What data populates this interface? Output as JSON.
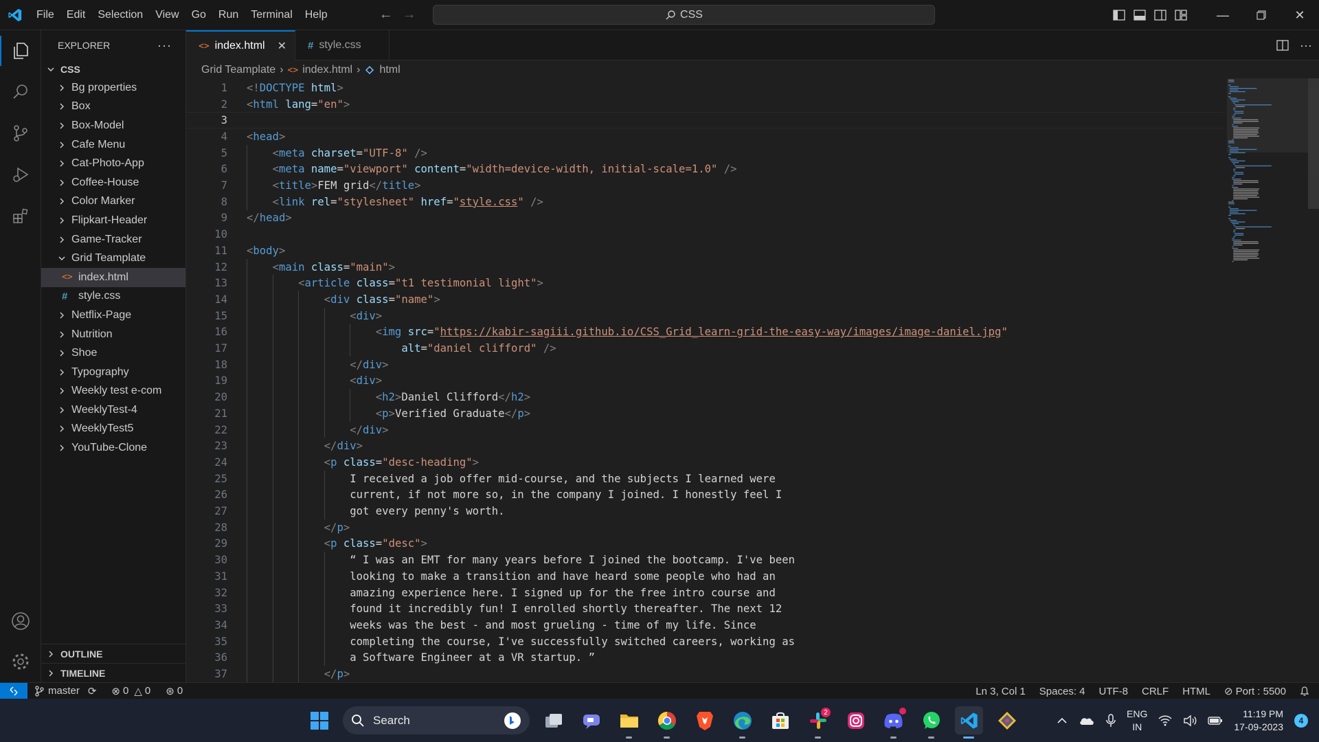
{
  "menu": [
    "File",
    "Edit",
    "Selection",
    "View",
    "Go",
    "Run",
    "Terminal",
    "Help"
  ],
  "command_center": "CSS",
  "explorer": {
    "title": "EXPLORER",
    "root": "CSS",
    "folders_before": [
      "Bg properties",
      "Box",
      "Box-Model",
      "Cafe Menu",
      "Cat-Photo-App",
      "Coffee-House",
      "Color Marker",
      "Flipkart-Header",
      "Game-Tracker"
    ],
    "open_folder": "Grid Teamplate",
    "files": [
      "index.html",
      "style.css"
    ],
    "folders_after": [
      "Netflix-Page",
      "Nutrition",
      "Shoe",
      "Typography",
      "Weekly test e-com",
      "WeeklyTest-4",
      "WeeklyTest5",
      "YouTube-Clone"
    ],
    "outline": "OUTLINE",
    "timeline": "TIMELINE"
  },
  "tabs": [
    {
      "label": "index.html",
      "active": true
    },
    {
      "label": "style.css",
      "active": false
    }
  ],
  "breadcrumb": [
    "Grid Teamplate",
    "index.html",
    "html"
  ],
  "editor": {
    "current_line": 3,
    "lines": [
      [
        [
          "br",
          "<!"
        ],
        [
          "doc",
          "DOCTYPE"
        ],
        [
          "text",
          " "
        ],
        [
          "attr",
          "html"
        ],
        [
          "br",
          ">"
        ]
      ],
      [
        [
          "br",
          "<"
        ],
        [
          "tag",
          "html"
        ],
        [
          "text",
          " "
        ],
        [
          "attr",
          "lang"
        ],
        [
          "text",
          "="
        ],
        [
          "str",
          "\"en\""
        ],
        [
          "br",
          ">"
        ]
      ],
      [],
      [
        [
          "br",
          "<"
        ],
        [
          "tag",
          "head"
        ],
        [
          "br",
          ">"
        ]
      ],
      [
        [
          "text",
          "    "
        ],
        [
          "br",
          "<"
        ],
        [
          "tag",
          "meta"
        ],
        [
          "text",
          " "
        ],
        [
          "attr",
          "charset"
        ],
        [
          "text",
          "="
        ],
        [
          "str",
          "\"UTF-8\""
        ],
        [
          "text",
          " "
        ],
        [
          "br",
          "/>"
        ]
      ],
      [
        [
          "text",
          "    "
        ],
        [
          "br",
          "<"
        ],
        [
          "tag",
          "meta"
        ],
        [
          "text",
          " "
        ],
        [
          "attr",
          "name"
        ],
        [
          "text",
          "="
        ],
        [
          "str",
          "\"viewport\""
        ],
        [
          "text",
          " "
        ],
        [
          "attr",
          "content"
        ],
        [
          "text",
          "="
        ],
        [
          "str",
          "\"width=device-width, initial-scale=1.0\""
        ],
        [
          "text",
          " "
        ],
        [
          "br",
          "/>"
        ]
      ],
      [
        [
          "text",
          "    "
        ],
        [
          "br",
          "<"
        ],
        [
          "tag",
          "title"
        ],
        [
          "br",
          ">"
        ],
        [
          "text",
          "FEM grid"
        ],
        [
          "br",
          "</"
        ],
        [
          "tag",
          "title"
        ],
        [
          "br",
          ">"
        ]
      ],
      [
        [
          "text",
          "    "
        ],
        [
          "br",
          "<"
        ],
        [
          "tag",
          "link"
        ],
        [
          "text",
          " "
        ],
        [
          "attr",
          "rel"
        ],
        [
          "text",
          "="
        ],
        [
          "str",
          "\"stylesheet\""
        ],
        [
          "text",
          " "
        ],
        [
          "attr",
          "href"
        ],
        [
          "text",
          "="
        ],
        [
          "str",
          "\""
        ],
        [
          "link",
          "style.css"
        ],
        [
          "str",
          "\""
        ],
        [
          "text",
          " "
        ],
        [
          "br",
          "/>"
        ]
      ],
      [
        [
          "br",
          "</"
        ],
        [
          "tag",
          "head"
        ],
        [
          "br",
          ">"
        ]
      ],
      [],
      [
        [
          "br",
          "<"
        ],
        [
          "tag",
          "body"
        ],
        [
          "br",
          ">"
        ]
      ],
      [
        [
          "text",
          "    "
        ],
        [
          "br",
          "<"
        ],
        [
          "tag",
          "main"
        ],
        [
          "text",
          " "
        ],
        [
          "attr",
          "class"
        ],
        [
          "text",
          "="
        ],
        [
          "str",
          "\"main\""
        ],
        [
          "br",
          ">"
        ]
      ],
      [
        [
          "text",
          "        "
        ],
        [
          "br",
          "<"
        ],
        [
          "tag",
          "article"
        ],
        [
          "text",
          " "
        ],
        [
          "attr",
          "class"
        ],
        [
          "text",
          "="
        ],
        [
          "str",
          "\"t1 testimonial light\""
        ],
        [
          "br",
          ">"
        ]
      ],
      [
        [
          "text",
          "            "
        ],
        [
          "br",
          "<"
        ],
        [
          "tag",
          "div"
        ],
        [
          "text",
          " "
        ],
        [
          "attr",
          "class"
        ],
        [
          "text",
          "="
        ],
        [
          "str",
          "\"name\""
        ],
        [
          "br",
          ">"
        ]
      ],
      [
        [
          "text",
          "                "
        ],
        [
          "br",
          "<"
        ],
        [
          "tag",
          "div"
        ],
        [
          "br",
          ">"
        ]
      ],
      [
        [
          "text",
          "                    "
        ],
        [
          "br",
          "<"
        ],
        [
          "tag",
          "img"
        ],
        [
          "text",
          " "
        ],
        [
          "attr",
          "src"
        ],
        [
          "text",
          "="
        ],
        [
          "str",
          "\""
        ],
        [
          "link",
          "https://kabir-sagiii.github.io/CSS_Grid_learn-grid-the-easy-way/images/image-daniel.jpg"
        ],
        [
          "str",
          "\""
        ]
      ],
      [
        [
          "text",
          "                        "
        ],
        [
          "attr",
          "alt"
        ],
        [
          "text",
          "="
        ],
        [
          "str",
          "\"daniel clifford\""
        ],
        [
          "text",
          " "
        ],
        [
          "br",
          "/>"
        ]
      ],
      [
        [
          "text",
          "                "
        ],
        [
          "br",
          "</"
        ],
        [
          "tag",
          "div"
        ],
        [
          "br",
          ">"
        ]
      ],
      [
        [
          "text",
          "                "
        ],
        [
          "br",
          "<"
        ],
        [
          "tag",
          "div"
        ],
        [
          "br",
          ">"
        ]
      ],
      [
        [
          "text",
          "                    "
        ],
        [
          "br",
          "<"
        ],
        [
          "tag",
          "h2"
        ],
        [
          "br",
          ">"
        ],
        [
          "text",
          "Daniel Clifford"
        ],
        [
          "br",
          "</"
        ],
        [
          "tag",
          "h2"
        ],
        [
          "br",
          ">"
        ]
      ],
      [
        [
          "text",
          "                    "
        ],
        [
          "br",
          "<"
        ],
        [
          "tag",
          "p"
        ],
        [
          "br",
          ">"
        ],
        [
          "text",
          "Verified Graduate"
        ],
        [
          "br",
          "</"
        ],
        [
          "tag",
          "p"
        ],
        [
          "br",
          ">"
        ]
      ],
      [
        [
          "text",
          "                "
        ],
        [
          "br",
          "</"
        ],
        [
          "tag",
          "div"
        ],
        [
          "br",
          ">"
        ]
      ],
      [
        [
          "text",
          "            "
        ],
        [
          "br",
          "</"
        ],
        [
          "tag",
          "div"
        ],
        [
          "br",
          ">"
        ]
      ],
      [
        [
          "text",
          "            "
        ],
        [
          "br",
          "<"
        ],
        [
          "tag",
          "p"
        ],
        [
          "text",
          " "
        ],
        [
          "attr",
          "class"
        ],
        [
          "text",
          "="
        ],
        [
          "str",
          "\"desc-heading\""
        ],
        [
          "br",
          ">"
        ]
      ],
      [
        [
          "text",
          "                I received a job offer mid-course, and the subjects I learned were"
        ]
      ],
      [
        [
          "text",
          "                current, if not more so, in the company I joined. I honestly feel I"
        ]
      ],
      [
        [
          "text",
          "                got every penny's worth."
        ]
      ],
      [
        [
          "text",
          "            "
        ],
        [
          "br",
          "</"
        ],
        [
          "tag",
          "p"
        ],
        [
          "br",
          ">"
        ]
      ],
      [
        [
          "text",
          "            "
        ],
        [
          "br",
          "<"
        ],
        [
          "tag",
          "p"
        ],
        [
          "text",
          " "
        ],
        [
          "attr",
          "class"
        ],
        [
          "text",
          "="
        ],
        [
          "str",
          "\"desc\""
        ],
        [
          "br",
          ">"
        ]
      ],
      [
        [
          "text",
          "                “ I was an EMT for many years before I joined the bootcamp. I've been"
        ]
      ],
      [
        [
          "text",
          "                looking to make a transition and have heard some people who had an"
        ]
      ],
      [
        [
          "text",
          "                amazing experience here. I signed up for the free intro course and"
        ]
      ],
      [
        [
          "text",
          "                found it incredibly fun! I enrolled shortly thereafter. The next 12"
        ]
      ],
      [
        [
          "text",
          "                weeks was the best - and most grueling - time of my life. Since"
        ]
      ],
      [
        [
          "text",
          "                completing the course, I've successfully switched careers, working as"
        ]
      ],
      [
        [
          "text",
          "                a Software Engineer at a VR startup. ”"
        ]
      ],
      [
        [
          "text",
          "            "
        ],
        [
          "br",
          "</"
        ],
        [
          "tag",
          "p"
        ],
        [
          "br",
          ">"
        ]
      ]
    ]
  },
  "status": {
    "branch": "master",
    "errors": "0",
    "warnings": "0",
    "ports": "0",
    "position": "Ln 3, Col 1",
    "spaces": "Spaces: 4",
    "encoding": "UTF-8",
    "eol": "CRLF",
    "language": "HTML",
    "port": "Port : 5500"
  },
  "taskbar": {
    "search": "Search",
    "lang_top": "ENG",
    "lang_bottom": "IN",
    "time": "11:19 PM",
    "date": "17-09-2023",
    "notifications": "4",
    "slack_badge": "2"
  },
  "colors": {
    "accent": "#0078d4",
    "editor_bg": "#1f1f1f",
    "chrome_bg": "#181818",
    "taskbar_bg": "#1c2230"
  }
}
